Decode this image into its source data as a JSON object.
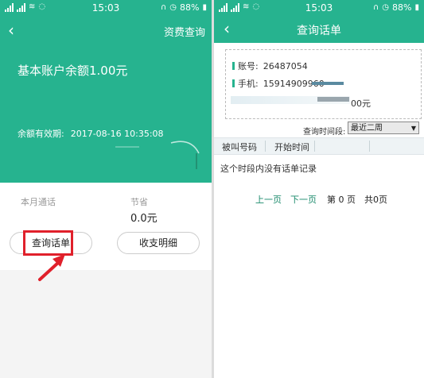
{
  "status_bar": {
    "time": "15:03",
    "battery": "88%"
  },
  "left_screen": {
    "header": {
      "fee_query_link": "资费查询"
    },
    "balance_text": "基本账户余额1.00元",
    "validity_label": "余额有效期:",
    "validity_value": "2017-08-16 10:35:08",
    "stats": {
      "monthly_calls_label": "本月通话",
      "savings_label": "节省",
      "savings_value": "0.0元"
    },
    "buttons": {
      "call_records": "查询话单",
      "billing_details": "收支明细"
    }
  },
  "right_screen": {
    "title": "查询话单",
    "account": {
      "account_label": "账号:",
      "account_value": "26487054",
      "phone_label": "手机:",
      "phone_value": "15914909960",
      "amount_tail": "00元"
    },
    "filter": {
      "label": "查询时间段:",
      "selected": "最近二周"
    },
    "table_headers": [
      "被叫号码",
      "开始时间"
    ],
    "empty_message": "这个时段内没有话单记录",
    "pagination": {
      "prev": "上一页",
      "next": "下一页",
      "current": "第 0 页",
      "total": "共0页"
    }
  },
  "colors": {
    "brand_green": "#26b38f",
    "highlight_red": "#e0202b"
  }
}
